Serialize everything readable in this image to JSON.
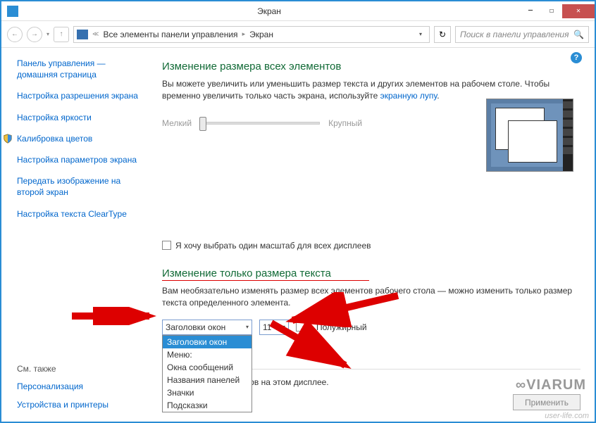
{
  "window": {
    "title": "Экран"
  },
  "toolbar": {
    "breadcrumb1": "Все элементы панели управления",
    "breadcrumb2": "Экран",
    "search_placeholder": "Поиск в панели управления"
  },
  "sidebar": {
    "items": [
      "Панель управления — домашняя страница",
      "Настройка разрешения экрана",
      "Настройка яркости",
      "Калибровка цветов",
      "Настройка параметров экрана",
      "Передать изображение на второй экран",
      "Настройка текста ClearType"
    ],
    "see_also_header": "См. также",
    "see_also": [
      "Персонализация",
      "Устройства и принтеры"
    ]
  },
  "main": {
    "heading1": "Изменение размера всех элементов",
    "desc1a": "Вы можете увеличить или уменьшить размер текста и других элементов на рабочем столе. Чтобы временно увеличить только часть экрана, используйте ",
    "desc1_link": "экранную лупу",
    "slider_min": "Мелкий",
    "slider_max": "Крупный",
    "checkbox1": "Я хочу выбрать один масштаб для всех дисплеев",
    "heading2": "Изменение только размера текста",
    "desc2": "Вам необязательно изменять размер всех элементов рабочего стола — можно изменить только размер текста определенного элемента.",
    "select_value": "Заголовки окон",
    "dropdown_options": [
      "Заголовки окон",
      "Меню:",
      "Окна сообщений",
      "Названия панелей",
      "Значки",
      "Подсказки"
    ],
    "size_value": "11",
    "bold_label": "Полужирный",
    "info_text": "нить размер эл            нтов на этом дисплее.",
    "apply_button": "Применить"
  },
  "watermark": {
    "main": "∞VIARUM",
    "sub": "user-life.com"
  }
}
